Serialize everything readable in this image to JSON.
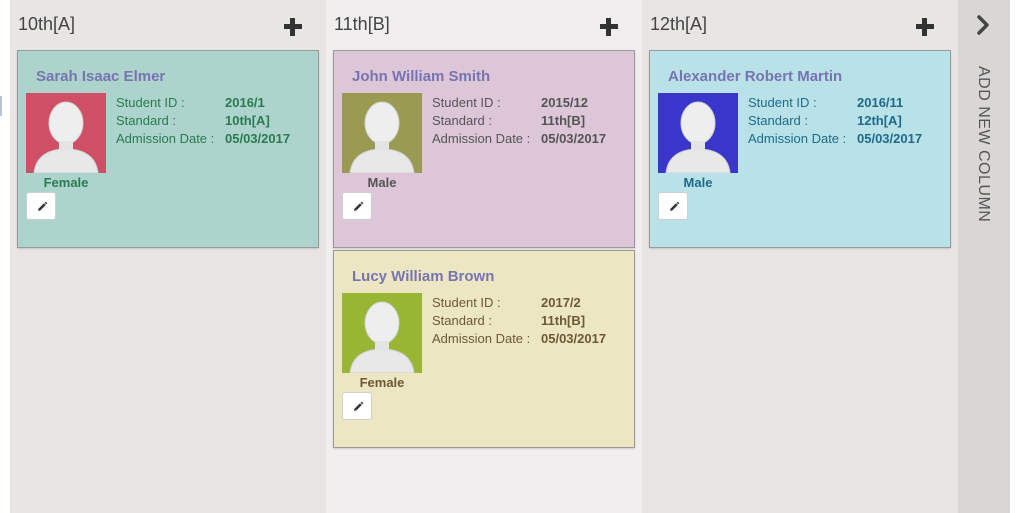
{
  "columns": [
    {
      "title": "10th[A]",
      "cards": [
        {
          "name": "Sarah Isaac Elmer",
          "gender": "Female",
          "student_id_label": "Student ID :",
          "student_id": "2016/1",
          "standard_label": "Standard :",
          "standard": "10th[A]",
          "admission_label": "Admission Date :",
          "admission_date": "05/03/2017",
          "card_color": "#acd4cc",
          "avatar_color": "#cf4f67",
          "text_color": "#2b7a52"
        }
      ]
    },
    {
      "title": "11th[B]",
      "cards": [
        {
          "name": "John William Smith",
          "gender": "Male",
          "student_id_label": "Student ID :",
          "student_id": "2015/12",
          "standard_label": "Standard :",
          "standard": "11th[B]",
          "admission_label": "Admission Date :",
          "admission_date": "05/03/2017",
          "card_color": "#dcc6d8",
          "avatar_color": "#9a9a52",
          "text_color": "#555555"
        },
        {
          "name": "Lucy William Brown",
          "gender": "Female",
          "student_id_label": "Student ID :",
          "student_id": "2017/2",
          "standard_label": "Standard :",
          "standard": "11th[B]",
          "admission_label": "Admission Date :",
          "admission_date": "05/03/2017",
          "card_color": "#ede6c2",
          "avatar_color": "#98b533",
          "text_color": "#6b5a34"
        }
      ]
    },
    {
      "title": "12th[A]",
      "cards": [
        {
          "name": "Alexander Robert Martin",
          "gender": "Male",
          "student_id_label": "Student ID :",
          "student_id": "2016/11",
          "standard_label": "Standard :",
          "standard": "12th[A]",
          "admission_label": "Admission Date :",
          "admission_date": "05/03/2017",
          "card_color": "#b8e2e8",
          "avatar_color": "#3a36cc",
          "text_color": "#1f6a8a"
        }
      ]
    }
  ],
  "add_column": {
    "label": "ADD NEW COLUMN",
    "icon": "chevron-right-icon"
  },
  "icons": {
    "add": "plus-icon",
    "edit": "pencil-icon",
    "avatar": "user-silhouette-icon"
  }
}
